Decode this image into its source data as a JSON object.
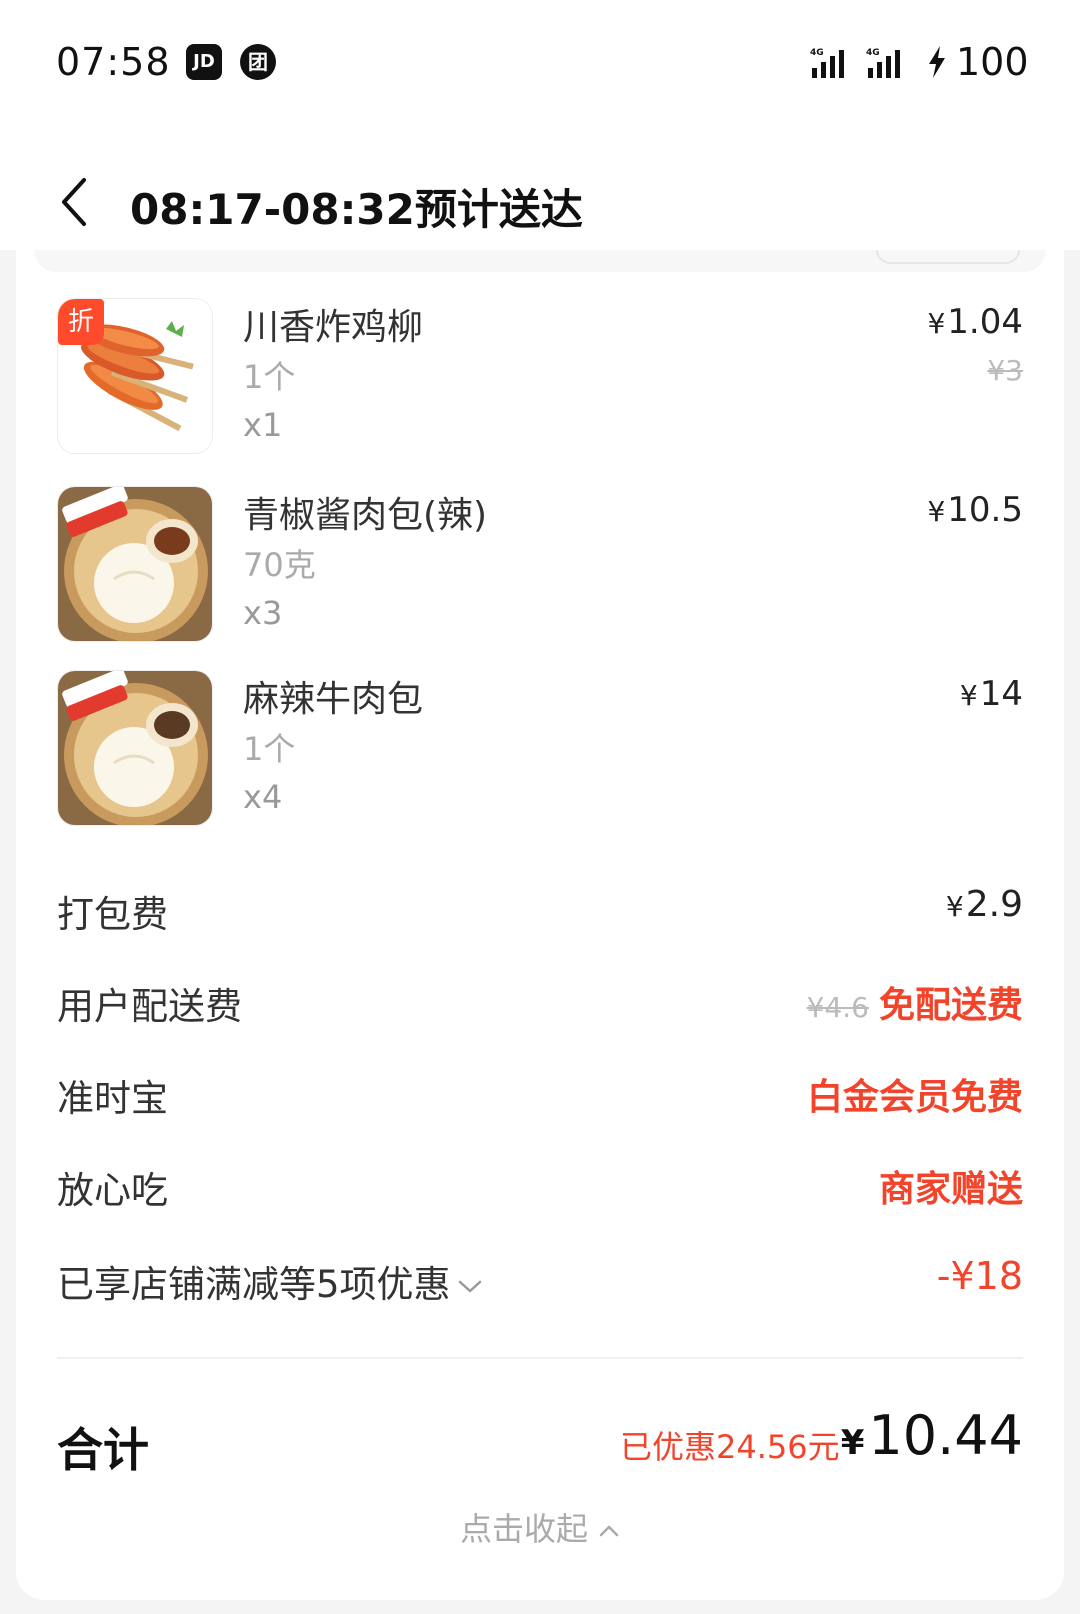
{
  "status_bar": {
    "time": "07:58",
    "badges": [
      "JD",
      "团"
    ],
    "signal_labels": [
      "4G",
      "4G"
    ],
    "battery": "100",
    "icons": [
      "jd-app-icon",
      "tuan-app-icon",
      "signal-4g-icon",
      "signal-4g-icon",
      "charging-bolt-icon"
    ]
  },
  "header": {
    "title": "08:17-08:32预计送达",
    "back_icon": "chevron-left-icon"
  },
  "products": [
    {
      "name": "川香炸鸡柳",
      "spec": "1个",
      "qty": "x1",
      "price": "1.04",
      "original_price": "¥3",
      "tag": "折",
      "thumb_kind": "chicken-strips"
    },
    {
      "name": "青椒酱肉包(辣)",
      "spec": "70克",
      "qty": "x3",
      "price": "10.5",
      "original_price": "",
      "tag": "",
      "thumb_kind": "steamed-bun"
    },
    {
      "name": "麻辣牛肉包",
      "spec": "1个",
      "qty": "x4",
      "price": "14",
      "original_price": "",
      "tag": "",
      "thumb_kind": "steamed-bun"
    }
  ],
  "fees": {
    "packaging": {
      "label": "打包费",
      "value": "2.9"
    },
    "delivery": {
      "label": "用户配送费",
      "original": "¥4.6",
      "value": "免配送费"
    },
    "ontime": {
      "label": "准时宝",
      "value": "白金会员免费"
    },
    "safe_eat": {
      "label": "放心吃",
      "value": "商家赠送"
    },
    "discounts": {
      "label": "已享店铺满减等5项优惠",
      "value": "-¥18"
    }
  },
  "total": {
    "label": "合计",
    "saved": "已优惠24.56元",
    "amount": "10.44"
  },
  "collapse_label": "点击收起",
  "currency_symbol": "¥",
  "colors": {
    "accent_red": "#f2432b",
    "text_dark": "#111111",
    "text_muted": "#aaaaaa"
  }
}
